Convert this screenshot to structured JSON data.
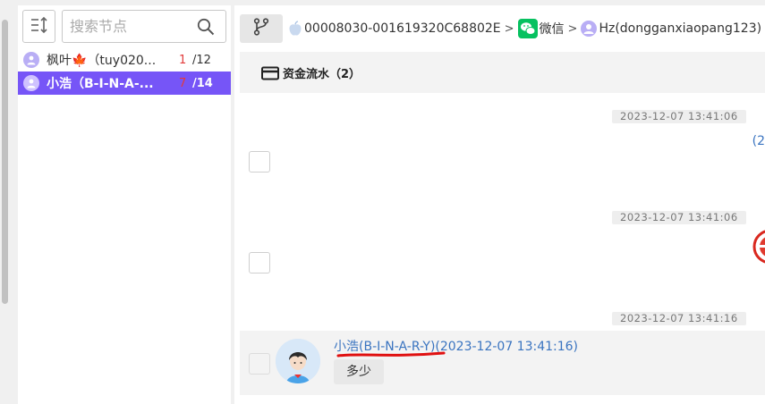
{
  "sidebar": {
    "search_placeholder": "搜索节点",
    "nodes": [
      {
        "label": "枫叶🍁（tuy020...",
        "unread": "1",
        "total": "/12",
        "selected": false
      },
      {
        "label": "小浩（B-I-N-A-...",
        "unread": "7",
        "total": "/14",
        "selected": true
      }
    ]
  },
  "breadcrumb": {
    "device": "00008030-001619320C68802E",
    "app": "微信",
    "account": "Hz(dongganxiaopang123)"
  },
  "tab": {
    "label": "资金流水（2）"
  },
  "chat": {
    "timestamps": [
      "2023-12-07 13:41:06",
      "2023-12-07 13:41:06",
      "2023-12-07 13:41:16"
    ],
    "edge_text": "(2",
    "message": {
      "sender": "小浩(B-I-N-A-R-Y)(2023-12-07 13:41:16)",
      "text": "多少"
    }
  },
  "colors": {
    "accent": "#7655f7",
    "link": "#3a74c0",
    "unread": "#e23b3b",
    "annotation": "#e01010",
    "wechat": "#07c160"
  }
}
